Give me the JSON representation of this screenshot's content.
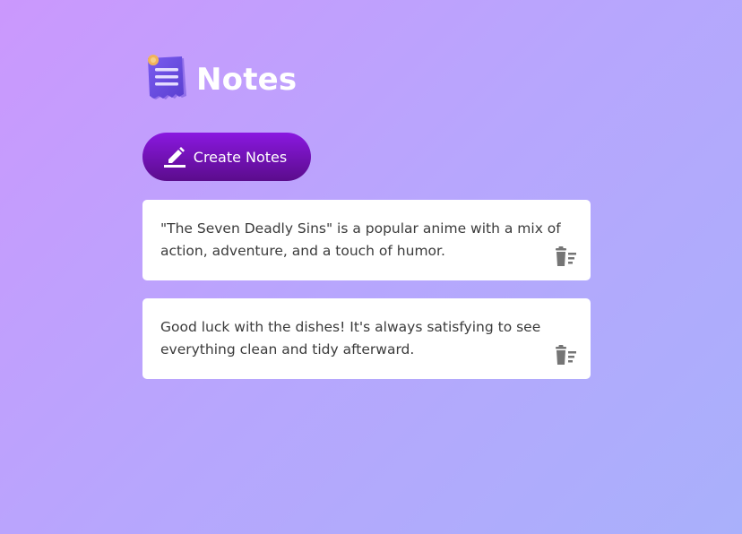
{
  "header": {
    "title": "Notes",
    "logo_icon": "notepad-icon"
  },
  "toolbar": {
    "create_label": "Create Notes",
    "create_icon": "edit-pencil-icon"
  },
  "notes": [
    {
      "text": "\"The Seven Deadly Sins\" is a popular anime with a mix of action, adventure, and a touch of humor.",
      "delete_icon": "delete-trash-icon"
    },
    {
      "text": "Good luck with the dishes! It's always satisfying to see everything clean and tidy afterward.",
      "delete_icon": "delete-trash-icon"
    }
  ],
  "colors": {
    "background_start": "#cb98fd",
    "background_end": "#a9b0fb",
    "button_top": "#8a18e0",
    "button_bottom": "#5b0c8c",
    "card": "#ffffff",
    "text": "#3b3b3b",
    "icon_gray": "#757575"
  }
}
